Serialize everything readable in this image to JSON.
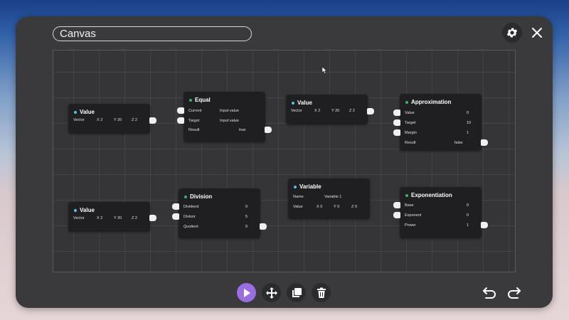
{
  "canvas": {
    "title": "Canvas"
  },
  "header": {
    "settings_icon": "gear-icon",
    "close_icon": "close-icon"
  },
  "toolbar": {
    "tools": [
      {
        "name": "select-tool",
        "icon": "pointer-icon",
        "active": true
      },
      {
        "name": "move-tool",
        "icon": "move-icon",
        "active": false
      },
      {
        "name": "duplicate-tool",
        "icon": "copy-icon",
        "active": false
      },
      {
        "name": "delete-tool",
        "icon": "trash-icon",
        "active": false
      }
    ],
    "undo_icon": "undo-icon",
    "redo_icon": "redo-icon",
    "accent": "#9a6ee0"
  },
  "nodes": {
    "value1": {
      "title": "Value",
      "dot": "#5bc0de",
      "label": "Vector",
      "x": "X 2",
      "y": "Y 20",
      "z": "Z 2"
    },
    "equal": {
      "title": "Equal",
      "dot": "#3cb371",
      "current_label": "Current",
      "current_value": "Input value",
      "target_label": "Target",
      "target_value": "Input value",
      "result_label": "Result",
      "result_value": "true"
    },
    "value2": {
      "title": "Value",
      "dot": "#5bc0de",
      "label": "Vector",
      "x": "X 2",
      "y": "Y 20",
      "z": "Z 2"
    },
    "approximation": {
      "title": "Approximation",
      "dot": "#3cb371",
      "value_label": "Value",
      "value_value": "0",
      "target_label": "Target",
      "target_value": "10",
      "margin_label": "Margin",
      "margin_value": "1",
      "result_label": "Result",
      "result_value": "false"
    },
    "value3": {
      "title": "Value",
      "dot": "#5bc0de",
      "label": "Vector",
      "x": "X 2",
      "y": "Y 20",
      "z": "Z 2"
    },
    "division": {
      "title": "Division",
      "dot": "#3cb371",
      "dividend_label": "Dividend",
      "dividend_value": "0",
      "divisor_label": "Divisor",
      "divisor_value": "5",
      "quotient_label": "Quotient",
      "quotient_value": "0"
    },
    "variable": {
      "title": "Variable",
      "dot": "#5bc0de",
      "name_label": "Name",
      "name_value": "Variable 1",
      "value_label": "Value",
      "x": "X 0",
      "y": "Y 0",
      "z": "Z 0"
    },
    "exponentiation": {
      "title": "Exponentiation",
      "dot": "#3cb371",
      "base_label": "Base",
      "base_value": "0",
      "exponent_label": "Exponent",
      "exponent_value": "0",
      "power_label": "Power",
      "power_value": "1"
    }
  }
}
